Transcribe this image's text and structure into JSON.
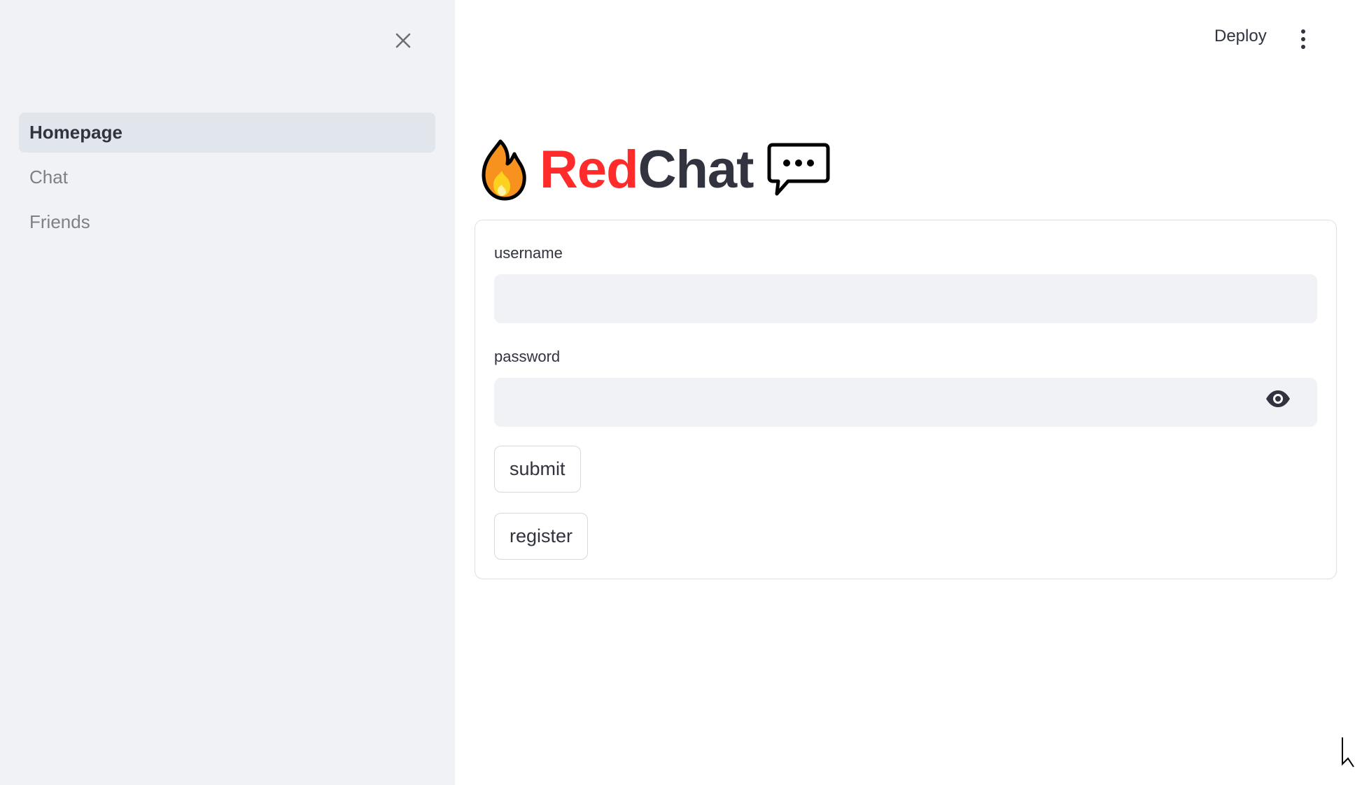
{
  "sidebar": {
    "close_icon": "close-icon",
    "items": [
      {
        "label": "Homepage",
        "active": true
      },
      {
        "label": "Chat",
        "active": false
      },
      {
        "label": "Friends",
        "active": false
      }
    ]
  },
  "header": {
    "deploy_label": "Deploy",
    "menu_icon": "kebab-menu-icon"
  },
  "title": {
    "emoji_left": "fire-icon",
    "part_red": "Red",
    "part_dark": "Chat",
    "emoji_right": "speech-bubble-icon"
  },
  "form": {
    "username_label": "username",
    "username_value": "",
    "password_label": "password",
    "password_value": "",
    "password_toggle_icon": "eye-icon",
    "submit_label": "submit",
    "register_label": "register"
  },
  "colors": {
    "accent_red": "#ff2b2b",
    "text": "#31333f",
    "sidebar_bg": "#f0f2f6",
    "input_bg": "#f0f2f6"
  }
}
